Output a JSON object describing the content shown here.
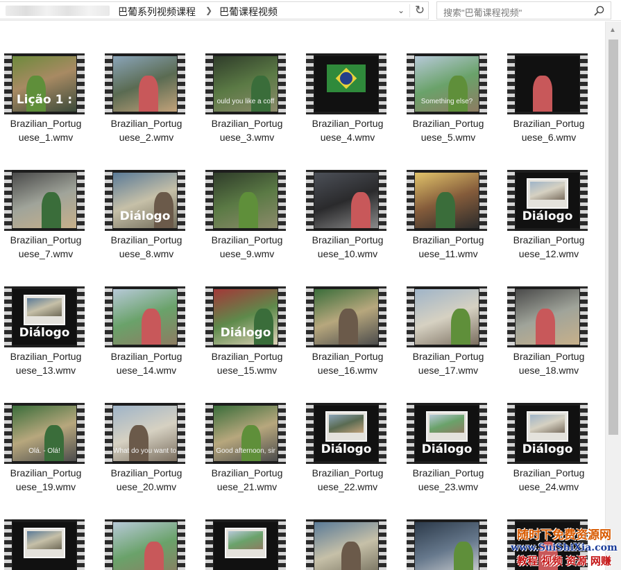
{
  "address_bar": {
    "breadcrumbs": [
      "巴葡系列视频课程",
      "巴葡课程视频"
    ],
    "separator_icon": "chevron-right-icon",
    "dropdown_icon": "chevron-down-icon",
    "refresh_icon": "refresh-icon"
  },
  "search": {
    "placeholder": "搜索\"巴葡课程视频\"",
    "icon": "search-icon"
  },
  "files": [
    {
      "name_line1": "Brazilian_Portug",
      "name_line2": "uese_1.wmv",
      "caption": "Lição 1 :",
      "caption_type": "title",
      "bg": "bg-0"
    },
    {
      "name_line1": "Brazilian_Portug",
      "name_line2": "uese_2.wmv",
      "caption": "",
      "caption_type": "none",
      "bg": "bg-1"
    },
    {
      "name_line1": "Brazilian_Portug",
      "name_line2": "uese_3.wmv",
      "caption": "ould you like a coff",
      "caption_type": "subtitle",
      "bg": "bg-2"
    },
    {
      "name_line1": "Brazilian_Portug",
      "name_line2": "uese_4.wmv",
      "caption": "",
      "caption_type": "flag",
      "bg": "bg-black"
    },
    {
      "name_line1": "Brazilian_Portug",
      "name_line2": "uese_5.wmv",
      "caption": "Something else?",
      "caption_type": "subtitle",
      "bg": "bg-5"
    },
    {
      "name_line1": "Brazilian_Portug",
      "name_line2": "uese_6.wmv",
      "caption": "",
      "caption_type": "none",
      "bg": "bg-black"
    },
    {
      "name_line1": "Brazilian_Portug",
      "name_line2": "uese_7.wmv",
      "caption": "",
      "caption_type": "none",
      "bg": "bg-10"
    },
    {
      "name_line1": "Brazilian_Portug",
      "name_line2": "uese_8.wmv",
      "caption": "Diálogo",
      "caption_type": "title",
      "bg": "bg-6"
    },
    {
      "name_line1": "Brazilian_Portug",
      "name_line2": "uese_9.wmv",
      "caption": "",
      "caption_type": "none",
      "bg": "bg-2"
    },
    {
      "name_line1": "Brazilian_Portug",
      "name_line2": "uese_10.wmv",
      "caption": "",
      "caption_type": "none",
      "bg": "bg-3"
    },
    {
      "name_line1": "Brazilian_Portug",
      "name_line2": "uese_11.wmv",
      "caption": "",
      "caption_type": "none",
      "bg": "bg-4"
    },
    {
      "name_line1": "Brazilian_Portug",
      "name_line2": "uese_12.wmv",
      "caption": "Diálogo",
      "caption_type": "slide",
      "bg": "bg-black"
    },
    {
      "name_line1": "Brazilian_Portug",
      "name_line2": "uese_13.wmv",
      "caption": "Diálogo",
      "caption_type": "slide",
      "bg": "bg-black"
    },
    {
      "name_line1": "Brazilian_Portug",
      "name_line2": "uese_14.wmv",
      "caption": "",
      "caption_type": "none",
      "bg": "bg-5"
    },
    {
      "name_line1": "Brazilian_Portug",
      "name_line2": "uese_15.wmv",
      "caption": "Diálogo",
      "caption_type": "title",
      "bg": "bg-7"
    },
    {
      "name_line1": "Brazilian_Portug",
      "name_line2": "uese_16.wmv",
      "caption": "",
      "caption_type": "none",
      "bg": "bg-8"
    },
    {
      "name_line1": "Brazilian_Portug",
      "name_line2": "uese_17.wmv",
      "caption": "",
      "caption_type": "none",
      "bg": "bg-9"
    },
    {
      "name_line1": "Brazilian_Portug",
      "name_line2": "uese_18.wmv",
      "caption": "",
      "caption_type": "none",
      "bg": "bg-10"
    },
    {
      "name_line1": "Brazilian_Portug",
      "name_line2": "uese_19.wmv",
      "caption": "Olá. - Olá!",
      "caption_type": "subtitle",
      "bg": "bg-8"
    },
    {
      "name_line1": "Brazilian_Portug",
      "name_line2": "uese_20.wmv",
      "caption": "What do you want to do now?",
      "caption_type": "subtitle",
      "bg": "bg-9"
    },
    {
      "name_line1": "Brazilian_Portug",
      "name_line2": "uese_21.wmv",
      "caption": "Good afternoon, sir",
      "caption_type": "subtitle",
      "bg": "bg-8"
    },
    {
      "name_line1": "Brazilian_Portug",
      "name_line2": "uese_22.wmv",
      "caption": "Diálogo",
      "caption_type": "slide",
      "bg": "bg-black"
    },
    {
      "name_line1": "Brazilian_Portug",
      "name_line2": "uese_23.wmv",
      "caption": "Diálogo",
      "caption_type": "slide",
      "bg": "bg-black"
    },
    {
      "name_line1": "Brazilian_Portug",
      "name_line2": "uese_24.wmv",
      "caption": "Diálogo",
      "caption_type": "slide",
      "bg": "bg-black"
    },
    {
      "name_line1": "",
      "name_line2": "",
      "caption": "",
      "caption_type": "slide",
      "bg": "bg-black"
    },
    {
      "name_line1": "",
      "name_line2": "",
      "caption": "",
      "caption_type": "none",
      "bg": "bg-5"
    },
    {
      "name_line1": "",
      "name_line2": "",
      "caption": "",
      "caption_type": "slide",
      "bg": "bg-black"
    },
    {
      "name_line1": "",
      "name_line2": "",
      "caption": "",
      "caption_type": "none",
      "bg": "bg-6"
    },
    {
      "name_line1": "",
      "name_line2": "",
      "caption": "",
      "caption_type": "none",
      "bg": "bg-11"
    },
    {
      "name_line1": "",
      "name_line2": "",
      "caption": "",
      "caption_type": "none",
      "bg": "bg-black"
    }
  ],
  "watermark": {
    "line1": "随时下免费资源网",
    "line2": "www.SuiShiXia.com",
    "line3": "教程 视频 资源 网赚"
  }
}
